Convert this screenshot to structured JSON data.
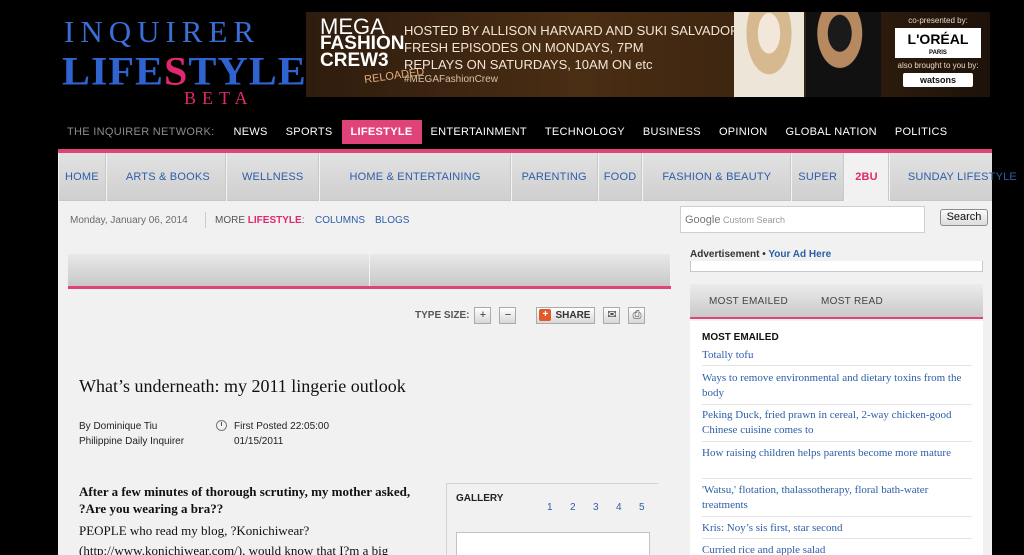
{
  "logo": {
    "line1": "INQUIRER",
    "line2a": "LIFE",
    "line2s": "S",
    "line2b": "TYLE",
    "line3": "BETA"
  },
  "banner": {
    "mega_line1": "MEGA",
    "mega_line2": "FASHION",
    "mega_line3": "CREW3",
    "reloaded": "RELOADED",
    "hosted": "HOSTED BY ALLISON HARVARD AND SUKI SALVADOR",
    "fresh": "FRESH EPISODES ON MONDAYS, 7PM",
    "replays": "REPLAYS ON SATURDAYS, 10AM ON",
    "channel": "etc",
    "hashtag": "#MEGAFashionCrew",
    "copresented": "co-presented by:",
    "loreal": "L'ORÉAL",
    "loreal_sub": "PARIS",
    "also": "also brought to you by:",
    "watsons": "watsons"
  },
  "network": {
    "label": "THE INQUIRER NETWORK:",
    "items": [
      "NEWS",
      "SPORTS",
      "LIFESTYLE",
      "ENTERTAINMENT",
      "TECHNOLOGY",
      "BUSINESS",
      "OPINION",
      "GLOBAL NATION",
      "POLITICS"
    ],
    "active": "LIFESTYLE"
  },
  "sections": [
    "HOME",
    "ARTS & BOOKS",
    "WELLNESS",
    "HOME & ENTERTAINING",
    "PARENTING",
    "FOOD",
    "FASHION & BEAUTY",
    "SUPER",
    "2BU",
    "SUNDAY LIFESTYLE"
  ],
  "subbar": {
    "date": "Monday, January 06, 2014",
    "more_prefix": "MORE ",
    "more_word": "LIFESTYLE",
    "more_suffix": ":",
    "columns": "COLUMNS",
    "blogs": "BLOGS",
    "search_brand": "Google",
    "search_placeholder": "Custom Search",
    "search_button": "Search"
  },
  "tools": {
    "type_size": "TYPE SIZE:",
    "plus": "+",
    "minus": "−",
    "share": "SHARE",
    "share_icon": "+"
  },
  "article": {
    "title": "What’s underneath: my 2011 lingerie outlook",
    "author": "By Dominique Tiu",
    "publication": "Philippine Daily Inquirer",
    "posted_label": "First Posted 22:05:00",
    "posted_date": "01/15/2011",
    "lead": "After a few minutes of thorough scrutiny, my mother asked, ?Are you wearing a bra??",
    "body_line1": "PEOPLE who read my blog, ?Konichiwear?",
    "body_line2": "(http://www.konichiwear.com/), would know that I?m a big"
  },
  "gallery": {
    "title": "GALLERY",
    "pages": [
      "1",
      "2",
      "3",
      "4",
      "5"
    ]
  },
  "ad": {
    "label": "Advertisement",
    "bullet": " • ",
    "link": "Your Ad Here"
  },
  "most": {
    "tab1": "MOST EMAILED",
    "tab2": "MOST READ",
    "heading": "MOST EMAILED",
    "items": [
      "Totally tofu",
      "Ways to remove environmental and dietary toxins from the body",
      "Peking Duck, fried prawn in cereal, 2-way chicken-good Chinese cuisine comes to",
      "How raising children helps parents become more mature",
      "'Watsu,' flotation, thalassotherapy, floral bath-water treatments",
      "Kris: Noy’s sis first, star second",
      "Curried rice and apple salad"
    ]
  },
  "colors": {
    "accent": "#e0437a",
    "link": "#2c5ea8",
    "logo_blue": "#2f63d0"
  }
}
